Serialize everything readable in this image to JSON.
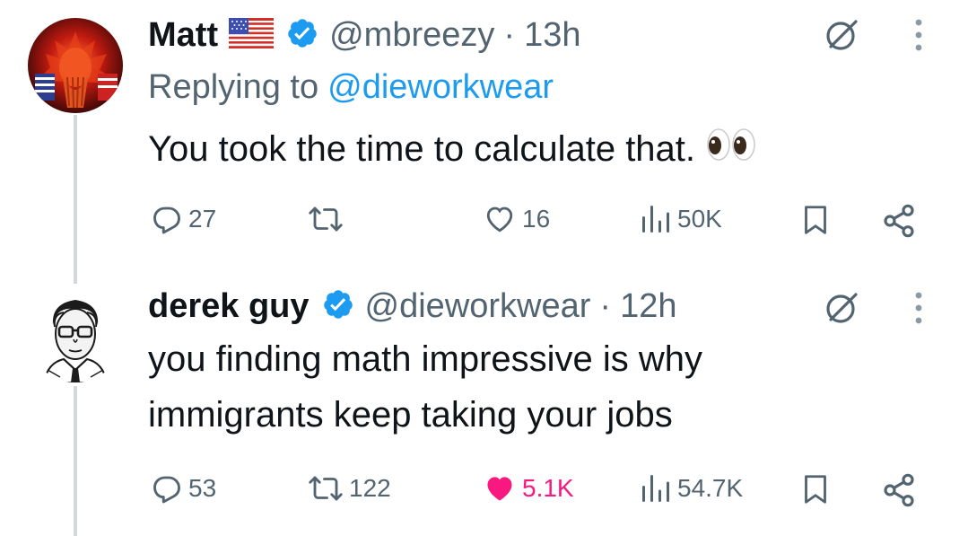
{
  "tweet1": {
    "name": "Matt",
    "handle": "@mbreezy",
    "separator": "·",
    "time": "13h",
    "replying_prefix": "Replying to",
    "replying_to": "@dieworkwear",
    "text": "You took the time to calculate that.",
    "emoji": "eyes-emoji",
    "stats": {
      "replies": "27",
      "retweets": "",
      "likes": "16",
      "views": "50K"
    },
    "liked": false
  },
  "tweet2": {
    "name": "derek guy",
    "handle": "@dieworkwear",
    "separator": "·",
    "time": "12h",
    "text_line1": "you finding math impressive is why",
    "text_line2": "immigrants keep taking your jobs",
    "stats": {
      "replies": "53",
      "retweets": "122",
      "likes": "5.1K",
      "views": "54.7K"
    },
    "liked": true
  },
  "colors": {
    "accent": "#1d9bf0",
    "like": "#f91880",
    "muted": "#536471",
    "thread_line": "#cfd9de",
    "verified": "#1d9bf0"
  }
}
